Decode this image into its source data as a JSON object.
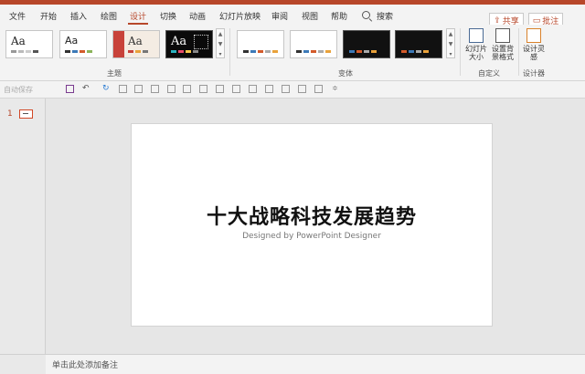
{
  "menu": {
    "tabs": [
      "文件",
      "开始",
      "插入",
      "绘图",
      "设计",
      "切换",
      "动画",
      "幻灯片放映",
      "审阅",
      "视图",
      "帮助"
    ],
    "search_label": "搜索",
    "share_label": "共享",
    "comment_label": "批注"
  },
  "ribbon": {
    "themes_group_label": "主题",
    "theme_sample_text": "Aa",
    "variants_group_label": "变体",
    "customize_group_label": "自定义",
    "designer_group_label": "设计器",
    "slide_size_label": "幻灯片大小",
    "format_background_label": "设置背景格式",
    "design_ideas_label": "设计灵感"
  },
  "qat": {
    "autosave_label": "自动保存"
  },
  "slides_pane": {
    "slide_number": "1"
  },
  "slide": {
    "title": "十大战略科技发展趋势",
    "subtitle": "Designed by  PowerPoint Designer"
  },
  "notes": {
    "placeholder": "单击此处添加备注"
  },
  "colors": {
    "accent": "#b7472a"
  }
}
